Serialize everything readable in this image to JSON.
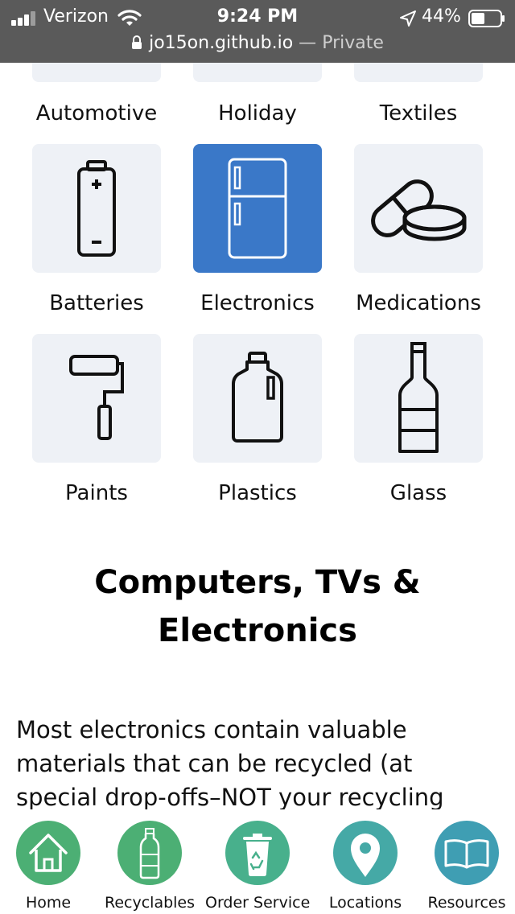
{
  "status_bar": {
    "carrier": "Verizon",
    "time": "9:24 PM",
    "battery_percent": "44%",
    "icons": [
      "signal-icon",
      "wifi-icon",
      "location-arrow-icon",
      "battery-icon"
    ]
  },
  "url_bar": {
    "lock_icon": "lock-icon",
    "domain": "jo15on.github.io",
    "separator": " — ",
    "mode": "Private"
  },
  "categories": {
    "top_row": [
      "Automotive",
      "Holiday",
      "Textiles"
    ],
    "items": [
      {
        "label": "Batteries",
        "icon": "battery-icon",
        "active": false
      },
      {
        "label": "Electronics",
        "icon": "refrigerator-icon",
        "active": true
      },
      {
        "label": "Medications",
        "icon": "pills-icon",
        "active": false
      },
      {
        "label": "Paints",
        "icon": "paint-roller-icon",
        "active": false
      },
      {
        "label": "Plastics",
        "icon": "plastic-jug-icon",
        "active": false
      },
      {
        "label": "Glass",
        "icon": "glass-bottle-icon",
        "active": false
      }
    ],
    "active_color": "#3a78c8",
    "tile_color": "#eef1f6"
  },
  "content": {
    "heading_line1": "Computers, TVs &",
    "heading_line2": "Electronics",
    "body_line1": "Most electronics contain valuable",
    "body_line2": "materials that can be recycled (at",
    "body_line3": "special drop-offs–NOT your recycling"
  },
  "bottom_nav": {
    "items": [
      {
        "label": "Home",
        "icon": "home-icon",
        "color": "#4caf74"
      },
      {
        "label": "Recyclables",
        "icon": "plastic-bottle-icon",
        "color": "#4caf74"
      },
      {
        "label": "Order Service",
        "icon": "recycle-bin-icon",
        "color": "#48b08c"
      },
      {
        "label": "Locations",
        "icon": "map-pin-icon",
        "color": "#45a9a6"
      },
      {
        "label": "Resources",
        "icon": "book-icon",
        "color": "#3f9eb3"
      }
    ]
  }
}
